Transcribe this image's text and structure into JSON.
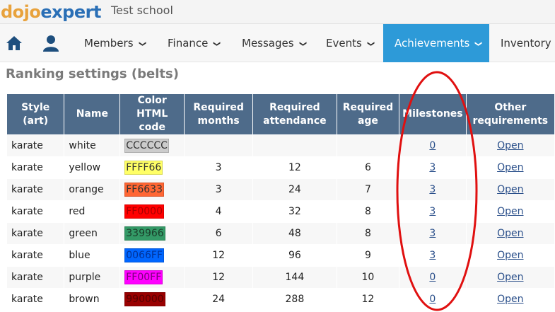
{
  "brand": {
    "logo_part1": "dojo",
    "logo_part2": "expert",
    "school_name": "Test school"
  },
  "nav": {
    "home_icon": "home-icon",
    "user_icon": "user-icon",
    "items": [
      {
        "label": "Members",
        "active": false
      },
      {
        "label": "Finance",
        "active": false
      },
      {
        "label": "Messages",
        "active": false
      },
      {
        "label": "Events",
        "active": false
      },
      {
        "label": "Achievements",
        "active": true
      },
      {
        "label": "Inventory",
        "active": false
      }
    ]
  },
  "page": {
    "title": "Ranking settings (belts)"
  },
  "table": {
    "headers": {
      "style_line1": "Style",
      "style_line2": "(art)",
      "name": "Name",
      "color_line1": "Color",
      "color_line2": "HTML code",
      "months_line1": "Required",
      "months_line2": "months",
      "attendance_line1": "Required",
      "attendance_line2": "attendance",
      "age_line1": "Required",
      "age_line2": "age",
      "milestones": "Milestones",
      "other_line1": "Other",
      "other_line2": "requirements"
    },
    "rows": [
      {
        "style": "karate",
        "name": "white",
        "color": "CCCCCC",
        "hex": "#CCCCCC",
        "text_color": "#333333",
        "months": "",
        "attendance": "",
        "age": "",
        "milestones": "0",
        "other": "Open"
      },
      {
        "style": "karate",
        "name": "yellow",
        "color": "FFFF66",
        "hex": "#FFFF66",
        "text_color": "#333333",
        "months": "3",
        "attendance": "12",
        "age": "6",
        "milestones": "3",
        "other": "Open"
      },
      {
        "style": "karate",
        "name": "orange",
        "color": "FF6633",
        "hex": "#FF6633",
        "text_color": "#333333",
        "months": "3",
        "attendance": "24",
        "age": "7",
        "milestones": "3",
        "other": "Open"
      },
      {
        "style": "karate",
        "name": "red",
        "color": "FF0000",
        "hex": "#FF0000",
        "text_color": "#aa0000",
        "months": "4",
        "attendance": "32",
        "age": "8",
        "milestones": "3",
        "other": "Open"
      },
      {
        "style": "karate",
        "name": "green",
        "color": "339966",
        "hex": "#339966",
        "text_color": "#1a3d2a",
        "months": "6",
        "attendance": "48",
        "age": "8",
        "milestones": "3",
        "other": "Open"
      },
      {
        "style": "karate",
        "name": "blue",
        "color": "0066FF",
        "hex": "#0066FF",
        "text_color": "#003399",
        "months": "12",
        "attendance": "96",
        "age": "9",
        "milestones": "3",
        "other": "Open"
      },
      {
        "style": "karate",
        "name": "purple",
        "color": "FF00FF",
        "hex": "#FF00FF",
        "text_color": "#7a007a",
        "months": "12",
        "attendance": "144",
        "age": "10",
        "milestones": "0",
        "other": "Open"
      },
      {
        "style": "karate",
        "name": "brown",
        "color": "990000",
        "hex": "#990000",
        "text_color": "#550000",
        "months": "24",
        "attendance": "288",
        "age": "12",
        "milestones": "0",
        "other": "Open"
      }
    ]
  },
  "colors": {
    "header_bg": "#4e6b8a",
    "active_nav": "#2d9ad8",
    "annotation": "#e01010"
  }
}
